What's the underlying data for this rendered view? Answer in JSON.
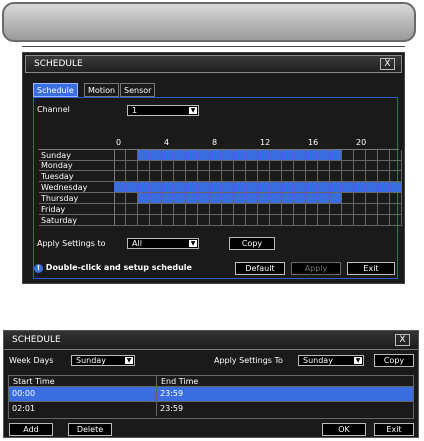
{
  "schedule_window": {
    "title": "SCHEDULE",
    "close_label": "X",
    "tabs": [
      {
        "label": "Schedule",
        "active": true
      },
      {
        "label": "Motion",
        "active": false
      },
      {
        "label": "Sensor",
        "active": false
      }
    ],
    "channel_label": "Channel",
    "channel_value": "1",
    "hour_labels": [
      "0",
      "4",
      "8",
      "12",
      "16",
      "20"
    ],
    "days": [
      {
        "name": "Sunday",
        "on": [
          false,
          false,
          true,
          true,
          true,
          true,
          true,
          true,
          true,
          true,
          true,
          true,
          true,
          true,
          true,
          true,
          true,
          true,
          true,
          false,
          false,
          false,
          false,
          false
        ]
      },
      {
        "name": "Monday",
        "on": [
          false,
          false,
          false,
          false,
          false,
          false,
          false,
          false,
          false,
          false,
          false,
          false,
          false,
          false,
          false,
          false,
          false,
          false,
          false,
          false,
          false,
          false,
          false,
          false
        ]
      },
      {
        "name": "Tuesday",
        "on": [
          false,
          false,
          false,
          false,
          false,
          false,
          false,
          false,
          false,
          false,
          false,
          false,
          false,
          false,
          false,
          false,
          false,
          false,
          false,
          false,
          false,
          false,
          false,
          false
        ]
      },
      {
        "name": "Wednesday",
        "on": [
          true,
          true,
          true,
          true,
          true,
          true,
          true,
          true,
          true,
          true,
          true,
          true,
          true,
          true,
          true,
          true,
          true,
          true,
          true,
          true,
          true,
          true,
          true,
          true
        ]
      },
      {
        "name": "Thursday",
        "on": [
          false,
          false,
          true,
          true,
          true,
          true,
          true,
          true,
          true,
          true,
          true,
          true,
          true,
          true,
          true,
          true,
          true,
          true,
          true,
          false,
          false,
          false,
          false,
          false
        ]
      },
      {
        "name": "Friday",
        "on": [
          false,
          false,
          false,
          false,
          false,
          false,
          false,
          false,
          false,
          false,
          false,
          false,
          false,
          false,
          false,
          false,
          false,
          false,
          false,
          false,
          false,
          false,
          false,
          false
        ]
      },
      {
        "name": "Saturday",
        "on": [
          false,
          false,
          false,
          false,
          false,
          false,
          false,
          false,
          false,
          false,
          false,
          false,
          false,
          false,
          false,
          false,
          false,
          false,
          false,
          false,
          false,
          false,
          false,
          false
        ]
      }
    ],
    "apply_settings_label": "Apply Settings to",
    "apply_settings_value": "All",
    "copy_label": "Copy",
    "hint_text": "Double-click and setup schedule",
    "default_label": "Default",
    "apply_label": "Apply",
    "exit_label": "Exit",
    "colors": {
      "accent": "#3a6ee0",
      "background": "#1a1a1a"
    }
  },
  "schedule_window_2": {
    "title": "SCHEDULE",
    "close_label": "X",
    "week_days_label": "Week Days",
    "week_days_value": "Sunday",
    "apply_settings_label": "Apply Settings To",
    "apply_settings_value": "Sunday",
    "copy_label": "Copy",
    "columns": [
      "Start Time",
      "End Time"
    ],
    "rows": [
      {
        "start": "00:00",
        "end": "23:59",
        "selected": true
      },
      {
        "start": "02:01",
        "end": "23:59",
        "selected": false
      }
    ],
    "add_label": "Add",
    "delete_label": "Delete",
    "ok_label": "OK",
    "exit_label": "Exit"
  }
}
